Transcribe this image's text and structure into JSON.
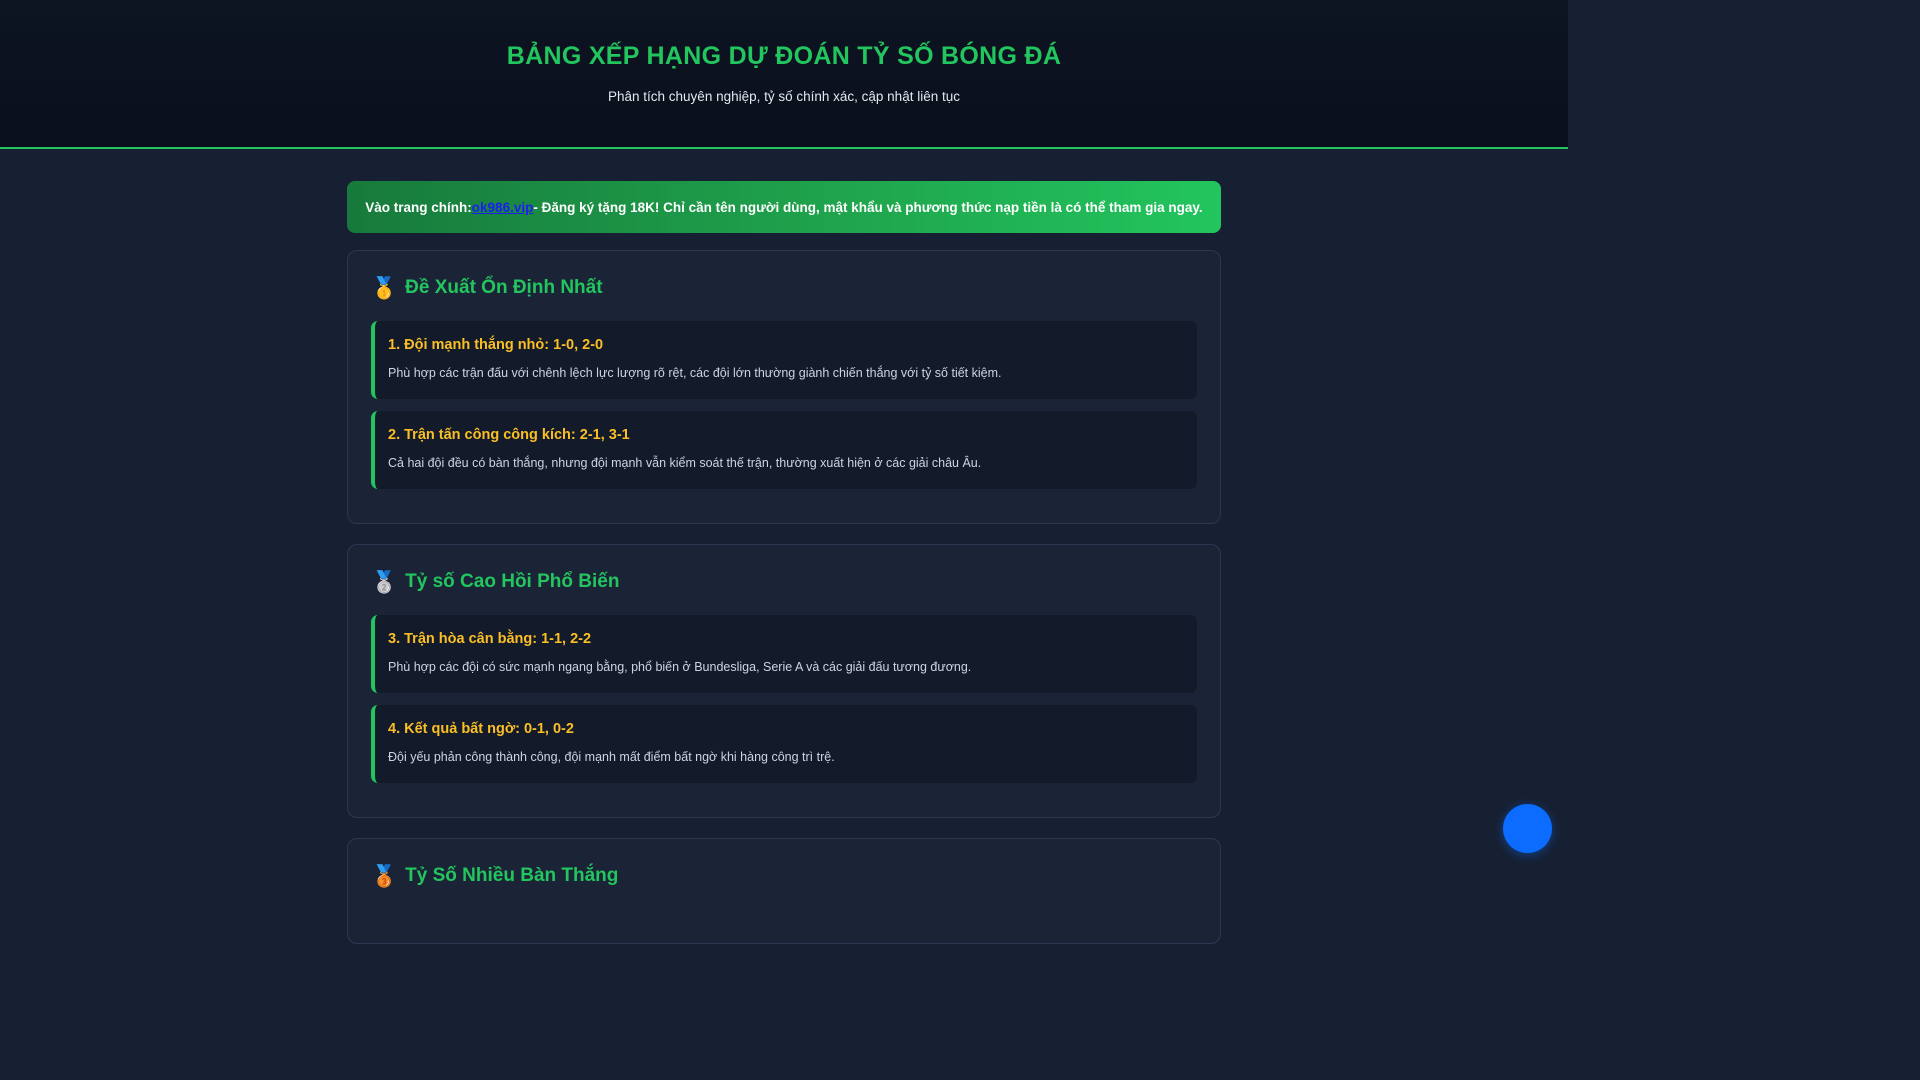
{
  "header": {
    "title": "BẢNG XẾP HẠNG DỰ ĐOÁN TỶ SỐ BÓNG ĐÁ",
    "subtitle": "Phân tích chuyên nghiệp, tỷ số chính xác, cập nhật liên tục"
  },
  "promo": {
    "prefix": "Vào trang chính: ",
    "link_text": "ok986.vip",
    "suffix": " - Đăng ký tặng 18K! Chỉ cần tên người dùng, mật khẩu và phương thức nạp tiền là có thể tham gia ngay."
  },
  "sections": [
    {
      "medal": "🥇",
      "title": "Đề Xuất Ổn Định Nhất",
      "items": [
        {
          "title": "1. Đội mạnh thắng nhỏ: 1-0, 2-0",
          "desc": "Phù hợp các trận đấu với chênh lệch lực lượng rõ rệt, các đội lớn thường giành chiến thắng với tỷ số tiết kiệm."
        },
        {
          "title": "2. Trận tấn công công kích: 2-1, 3-1",
          "desc": "Cả hai đội đều có bàn thắng, nhưng đội mạnh vẫn kiểm soát thế trận, thường xuất hiện ở các giải châu Âu."
        }
      ]
    },
    {
      "medal": "🥈",
      "title": "Tỷ số Cao Hồi Phổ Biến",
      "items": [
        {
          "title": "3. Trận hòa cân bằng: 1-1, 2-2",
          "desc": "Phù hợp các đội có sức mạnh ngang bằng, phổ biến ở Bundesliga, Serie A và các giải đấu tương đương."
        },
        {
          "title": "4. Kết quả bất ngờ: 0-1, 0-2",
          "desc": "Đội yếu phản công thành công, đội mạnh mất điểm bất ngờ khi hàng công trì trệ."
        }
      ]
    },
    {
      "medal": "🥉",
      "title": "Tỷ Số Nhiều Bàn Thắng"
    }
  ],
  "colors": {
    "accent": "#22c55e",
    "item_title": "#fbbf24",
    "chat_button": "#0b6cff"
  }
}
